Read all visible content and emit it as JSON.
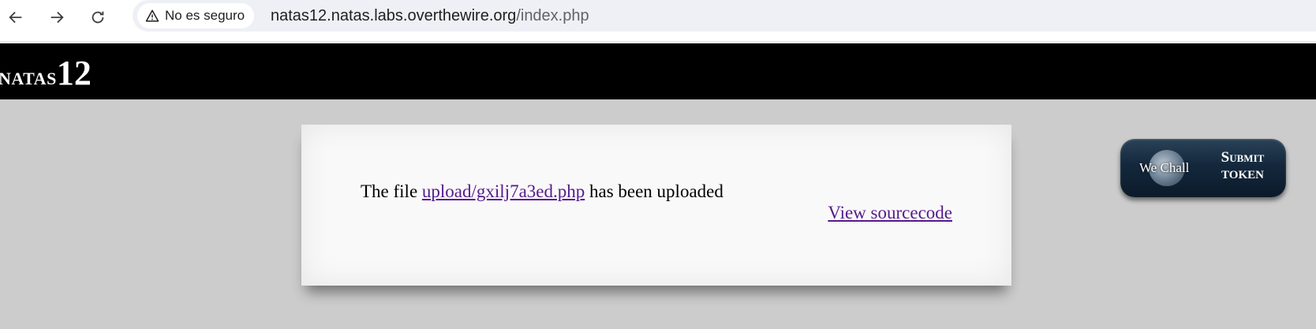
{
  "browser": {
    "security_label": "No es seguro",
    "url_host": "natas12.natas.labs.overthewire.org",
    "url_path": "/index.php"
  },
  "header": {
    "logo_word": "NATAS",
    "logo_number": "12"
  },
  "content": {
    "message_prefix": "The file ",
    "uploaded_file_link": "upload/gxilj7a3ed.php",
    "message_suffix": " has been uploaded",
    "view_source_link": "View sourcecode"
  },
  "token_button": {
    "brand": "We Chall",
    "line1": "Submit",
    "line2": "TOKEN"
  },
  "colors": {
    "page_background": "#cccccc",
    "header_background": "#000000",
    "link_visited": "#551a8b"
  }
}
